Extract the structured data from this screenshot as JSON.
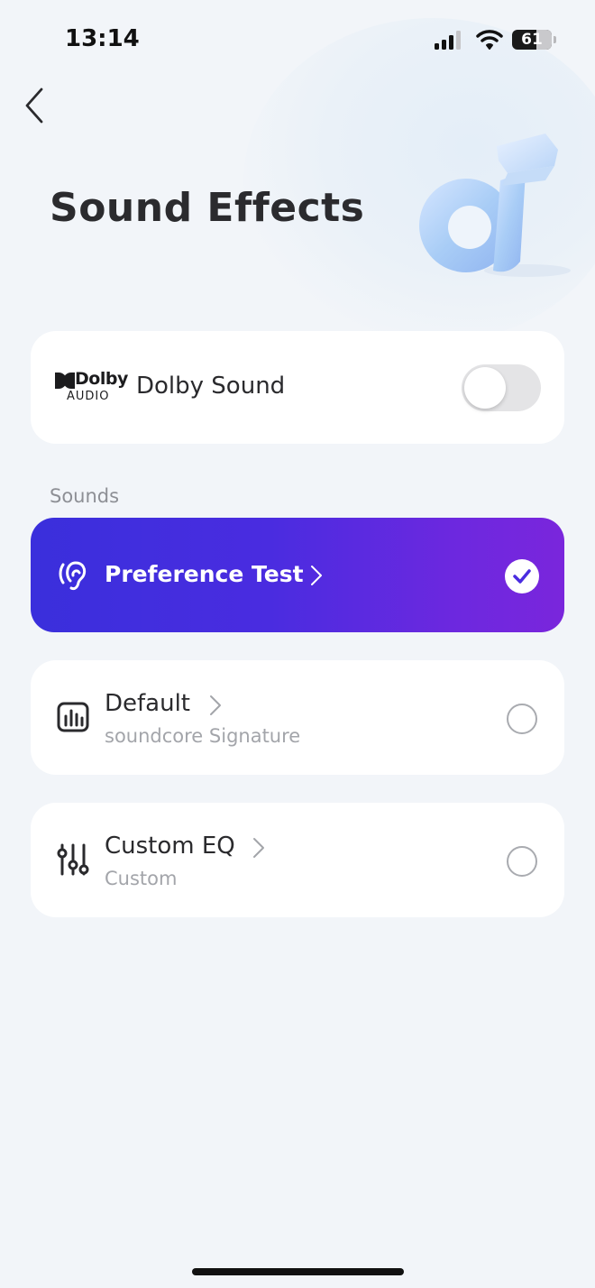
{
  "status_bar": {
    "time": "13:14",
    "battery_level": "61",
    "battery_fraction": 0.61
  },
  "header": {
    "back_icon": "chevron-left-icon",
    "title": "Sound Effects",
    "hero_icon": "music-note-3d-icon"
  },
  "dolby": {
    "logo_word": "Dolby",
    "logo_sub": "AUDIO",
    "label": "Dolby Sound",
    "enabled": false
  },
  "sounds": {
    "section_label": "Sounds",
    "items": [
      {
        "title": "Preference Test",
        "subtitle": "",
        "icon": "ear-icon",
        "selected": true
      },
      {
        "title": "Default",
        "subtitle": "soundcore Signature",
        "icon": "equalizer-bars-icon",
        "selected": false
      },
      {
        "title": "Custom EQ",
        "subtitle": "Custom",
        "icon": "sliders-icon",
        "selected": false
      }
    ]
  },
  "colors": {
    "accent_start": "#3a2fdc",
    "accent_end": "#7a26dc",
    "background": "#f2f5f9",
    "card": "#ffffff"
  }
}
